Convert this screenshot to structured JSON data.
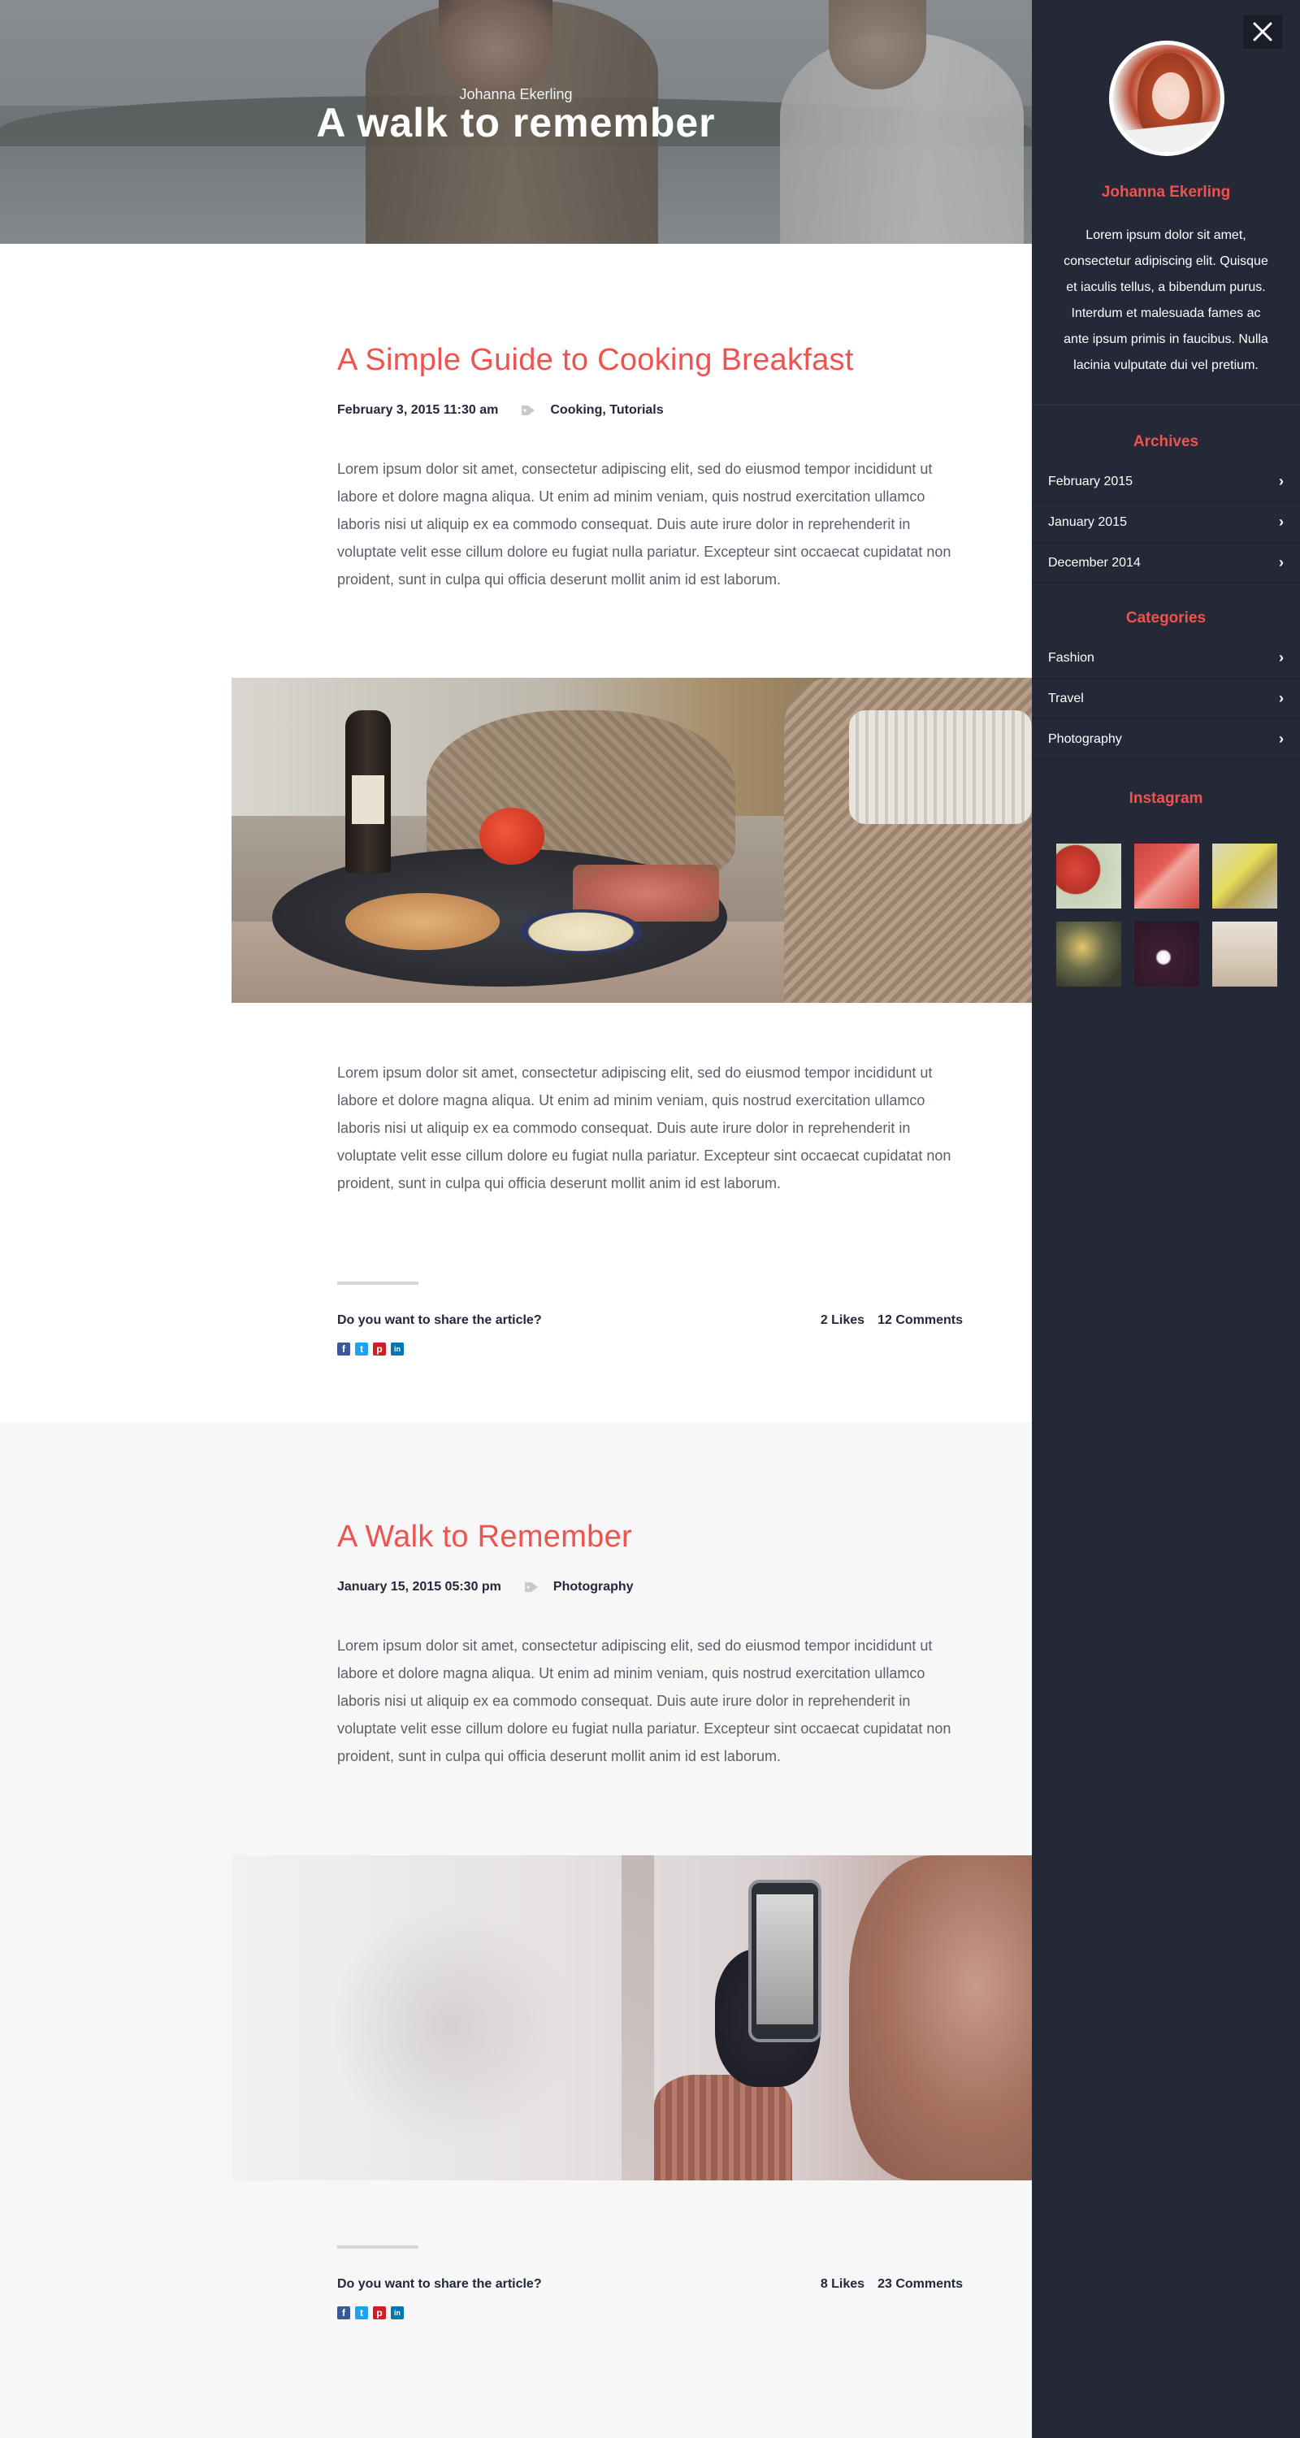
{
  "hero": {
    "author": "Johanna Ekerling",
    "title": "A walk to remember"
  },
  "posts": [
    {
      "title": "A Simple Guide to Cooking Breakfast",
      "date": "February 3, 2015 11:30 am",
      "categories": [
        "Cooking",
        "Tutorials"
      ],
      "paragraph_1": "Lorem ipsum dolor sit amet, consectetur adipiscing elit, sed do eiusmod tempor incididunt ut labore et dolore magna aliqua. Ut enim ad minim veniam, quis nostrud exercitation ullamco laboris nisi ut aliquip ex ea commodo consequat. Duis aute irure dolor in reprehenderit in voluptate velit esse cillum dolore eu fugiat nulla pariatur. Excepteur sint occaecat cupidatat non proident, sunt in culpa qui officia deserunt mollit anim id est laborum.",
      "paragraph_2": "Lorem ipsum dolor sit amet, consectetur adipiscing elit, sed do eiusmod tempor incididunt ut labore et dolore magna aliqua. Ut enim ad minim veniam, quis nostrud exercitation ullamco laboris nisi ut aliquip ex ea commodo consequat. Duis aute irure dolor in reprehenderit in voluptate velit esse cillum dolore eu fugiat nulla pariatur. Excepteur sint occaecat cupidatat non proident, sunt in culpa qui officia deserunt mollit anim id est laborum.",
      "share_question": "Do you want to share the article?",
      "likes": "2 Likes",
      "comments": "12 Comments"
    },
    {
      "title": "A Walk to Remember",
      "date": "January 15, 2015 05:30 pm",
      "categories": [
        "Photography"
      ],
      "paragraph_1": "Lorem ipsum dolor sit amet, consectetur adipiscing elit, sed do eiusmod tempor incididunt ut labore et dolore magna aliqua. Ut enim ad minim veniam, quis nostrud exercitation ullamco laboris nisi ut aliquip ex ea commodo consequat. Duis aute irure dolor in reprehenderit in voluptate velit esse cillum dolore eu fugiat nulla pariatur. Excepteur sint occaecat cupidatat non proident, sunt in culpa qui officia deserunt mollit anim id est laborum.",
      "share_question": "Do you want to share the article?",
      "likes": "8 Likes",
      "comments": "23 Comments"
    }
  ],
  "share_icons": [
    {
      "icon": "facebook-icon",
      "glyph": "f",
      "color": "#3b5998"
    },
    {
      "icon": "twitter-icon",
      "glyph": "t",
      "color": "#1da1f2"
    },
    {
      "icon": "pinterest-icon",
      "glyph": "p",
      "color": "#cb2027"
    },
    {
      "icon": "linkedin-icon",
      "glyph": "in",
      "color": "#0077b5"
    }
  ],
  "sidebar": {
    "name": "Johanna Ekerling",
    "bio": "Lorem ipsum dolor sit amet, consectetur adipiscing elit. Quisque et iaculis tellus, a bibendum purus. Interdum et malesuada fames ac ante ipsum primis in faucibus. Nulla lacinia vulputate dui vel pretium.",
    "archives_heading": "Archives",
    "archives": [
      "February 2015",
      "January 2015",
      "December 2014"
    ],
    "categories_heading": "Categories",
    "categories": [
      "Fashion",
      "Travel",
      "Photography"
    ],
    "instagram_heading": "Instagram",
    "close_icon": "close-icon",
    "chevron_icon": "chevron-right-icon"
  },
  "colors": {
    "accent": "#ef5350",
    "sidebar_bg": "#252836",
    "text_dark": "#23283a",
    "text_body": "#5a5f6b"
  }
}
